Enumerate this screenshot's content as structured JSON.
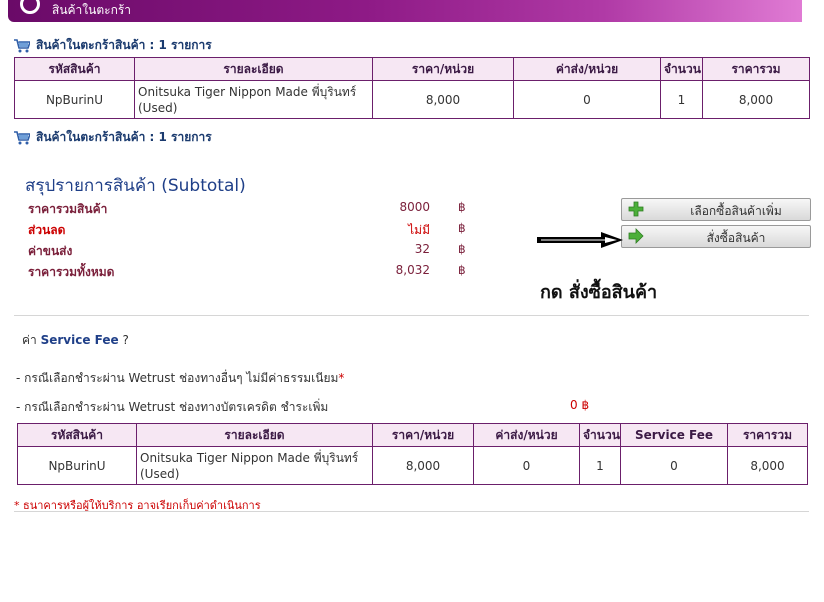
{
  "banner": {
    "title": "สินค้าในตะกร้า"
  },
  "cart": {
    "summary_text": "สินค้าในตะกร้าสินค้า : 1 รายการ"
  },
  "table1": {
    "headers": [
      "รหัสสินค้า",
      "รายละเอียด",
      "ราคา/หน่วย",
      "ค่าส่ง/หน่วย",
      "จำนวน",
      "ราคารวม"
    ],
    "rows": [
      {
        "code": "NpBurinU",
        "desc": "Onitsuka Tiger Nippon Made พี่บุรินทร์ (Used)",
        "unit_price": "8,000",
        "ship_unit": "0",
        "qty": "1",
        "total": "8,000"
      }
    ]
  },
  "subtotal": {
    "title": "สรุปรายการสินค้า (Subtotal)",
    "rows": [
      {
        "label": "ราคารวมสินค้า",
        "value": "8000",
        "currency": "฿"
      },
      {
        "label": "ส่วนลด",
        "value": "ไม่มี",
        "currency": "฿"
      },
      {
        "label": "ค่าขนส่ง",
        "value": "32",
        "currency": "฿"
      },
      {
        "label": "ราคารวมทั้งหมด",
        "value": "8,032",
        "currency": "฿"
      }
    ]
  },
  "buttons": {
    "continue_label": "เลือกซื้อสินค้าเพิ่ม",
    "order_label": "สั่งซื้อสินค้า"
  },
  "annotation": {
    "hint": "กด สั่งซื้อสินค้า"
  },
  "service_fee": {
    "title_prefix": "ค่า",
    "title_bold": "Service Fee",
    "title_suffix": "?",
    "note1": "- กรณีเลือกชำระผ่าน Wetrust ช่องทางอื่นๆ ไม่มีค่าธรรมเนียม",
    "note1_star": "*",
    "note2": "- กรณีเลือกชำระผ่าน Wetrust ช่องทางบัตรเครดิต ชำระเพิ่ม",
    "amount": "0 ฿"
  },
  "table2": {
    "headers": [
      "รหัสสินค้า",
      "รายละเอียด",
      "ราคา/หน่วย",
      "ค่าส่ง/หน่วย",
      "จำนวน",
      "Service Fee",
      "ราคารวม"
    ],
    "rows": [
      {
        "code": "NpBurinU",
        "desc": "Onitsuka Tiger Nippon Made พี่บุรินทร์ (Used)",
        "unit_price": "8,000",
        "ship_unit": "0",
        "qty": "1",
        "fee": "0",
        "total": "8,000"
      }
    ]
  },
  "footer": {
    "note": "* ธนาคารหรือผู้ให้บริการ อาจเรียกเก็บค่าดำเนินการ"
  },
  "colors": {
    "banner": "#7a0f74",
    "border": "#6b1f6b",
    "header_bg": "#f6e7f3",
    "label": "#7a1f3a",
    "accent_red": "#cc0000",
    "title_blue": "#1f3f88"
  }
}
